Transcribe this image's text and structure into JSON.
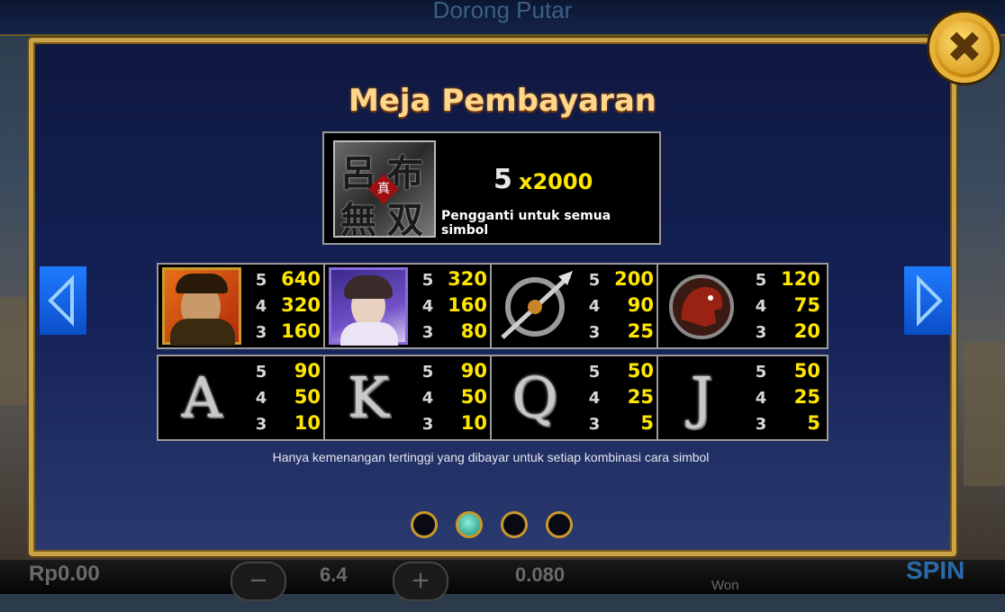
{
  "header": {
    "title": "Dorong Putar"
  },
  "bottom_bar": {
    "credit": "Rp0.00",
    "bet": "6.4",
    "coin": "0.080",
    "won_label": "Won",
    "spin_label": "SPIN",
    "minus": "−",
    "plus": "+"
  },
  "modal": {
    "title": "Meja Pembayaran",
    "close_label": "✖",
    "wild": {
      "logo_chars": [
        "呂",
        "布",
        "無",
        "双"
      ],
      "logo_center": "真",
      "count": "5",
      "payout": "x2000",
      "description": "Pengganti untuk semua simbol"
    },
    "row1": [
      {
        "icon": "warrior-portrait-icon",
        "pays": [
          {
            "n": "5",
            "v": "640"
          },
          {
            "n": "4",
            "v": "320"
          },
          {
            "n": "3",
            "v": "160"
          }
        ]
      },
      {
        "icon": "lady-portrait-icon",
        "pays": [
          {
            "n": "5",
            "v": "320"
          },
          {
            "n": "4",
            "v": "160"
          },
          {
            "n": "3",
            "v": "80"
          }
        ]
      },
      {
        "icon": "halberd-weapon-icon",
        "pays": [
          {
            "n": "5",
            "v": "200"
          },
          {
            "n": "4",
            "v": "90"
          },
          {
            "n": "3",
            "v": "25"
          }
        ]
      },
      {
        "icon": "red-horse-icon",
        "pays": [
          {
            "n": "5",
            "v": "120"
          },
          {
            "n": "4",
            "v": "75"
          },
          {
            "n": "3",
            "v": "20"
          }
        ]
      }
    ],
    "row2": [
      {
        "letter": "A",
        "pays": [
          {
            "n": "5",
            "v": "90"
          },
          {
            "n": "4",
            "v": "50"
          },
          {
            "n": "3",
            "v": "10"
          }
        ]
      },
      {
        "letter": "K",
        "pays": [
          {
            "n": "5",
            "v": "90"
          },
          {
            "n": "4",
            "v": "50"
          },
          {
            "n": "3",
            "v": "10"
          }
        ]
      },
      {
        "letter": "Q",
        "pays": [
          {
            "n": "5",
            "v": "50"
          },
          {
            "n": "4",
            "v": "25"
          },
          {
            "n": "3",
            "v": "5"
          }
        ]
      },
      {
        "letter": "J",
        "pays": [
          {
            "n": "5",
            "v": "50"
          },
          {
            "n": "4",
            "v": "25"
          },
          {
            "n": "3",
            "v": "5"
          }
        ]
      }
    ],
    "footnote": "Hanya kemenangan tertinggi yang dibayar untuk setiap kombinasi cara simbol",
    "pages": {
      "count": 4,
      "active": 2
    }
  }
}
